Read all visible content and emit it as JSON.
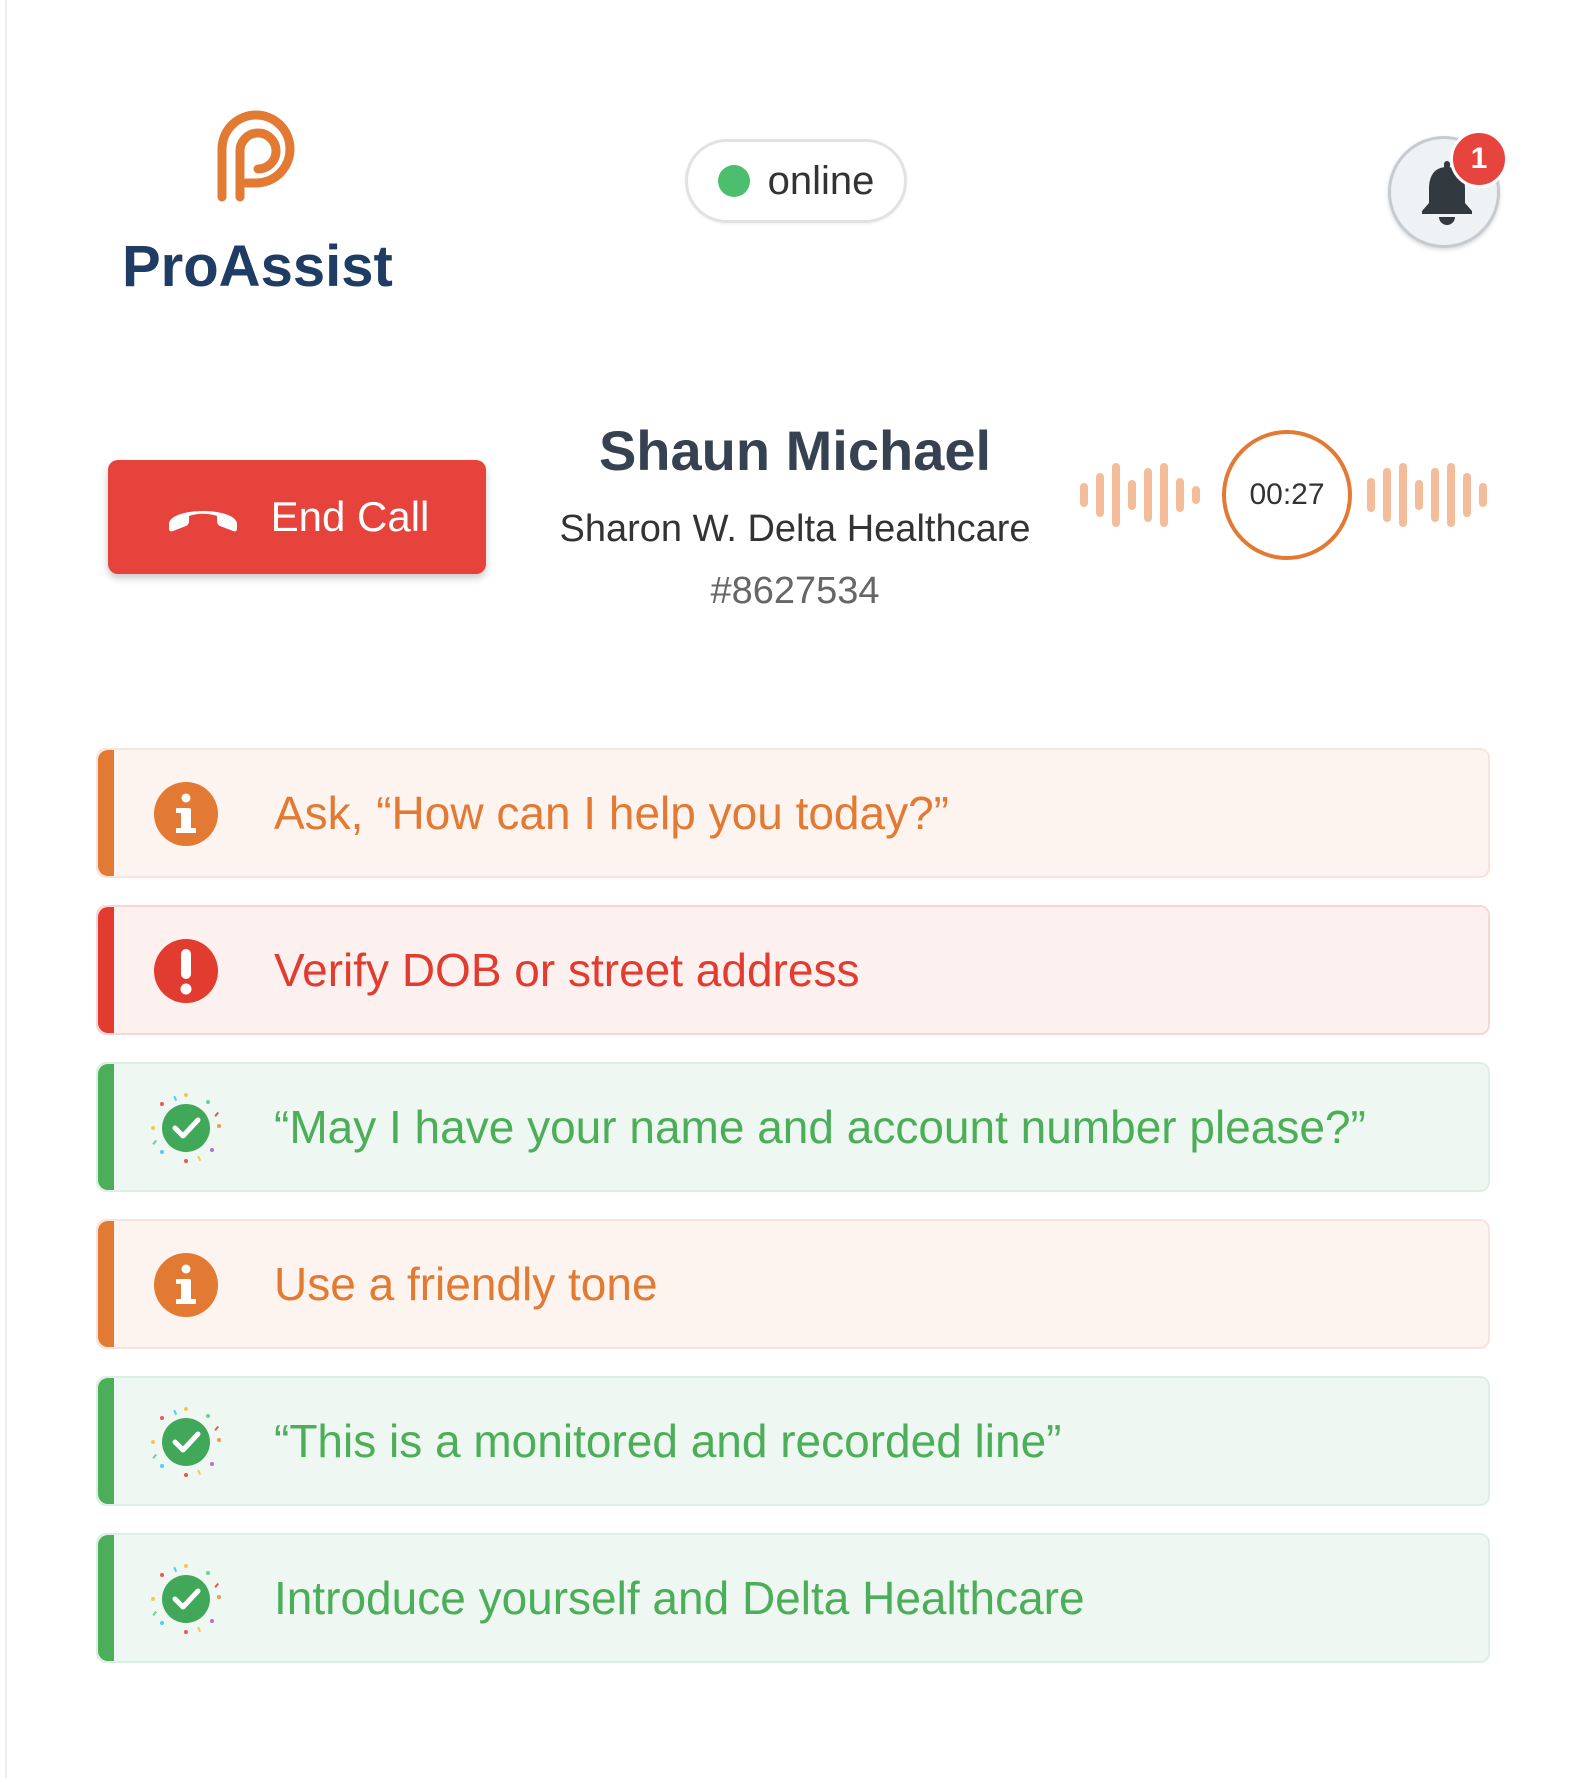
{
  "brand": {
    "name": "ProAssist",
    "accent": "#e27a34",
    "text_color": "#1f3c64"
  },
  "status": {
    "label": "online",
    "color": "#4cbf6e"
  },
  "notifications": {
    "count": "1",
    "icon": "bell-icon"
  },
  "call": {
    "end_label": "End Call",
    "end_icon": "phone-hangup-icon",
    "caller_name": "Shaun Michael",
    "caller_org": "Sharon W. Delta Healthcare",
    "caller_id": "#8627534",
    "timer": "00:27"
  },
  "tasks": [
    {
      "type": "info",
      "icon": "info-icon",
      "text": "Ask, “How can I help you today?”"
    },
    {
      "type": "warn",
      "icon": "alert-icon",
      "text": "Verify DOB or street address"
    },
    {
      "type": "done",
      "icon": "check-celebrate-icon",
      "text": "“May I have your name and account number please?”"
    },
    {
      "type": "info",
      "icon": "info-icon",
      "text": "Use a friendly tone"
    },
    {
      "type": "done",
      "icon": "check-celebrate-icon",
      "text": "“This is a monitored and recorded line”"
    },
    {
      "type": "done",
      "icon": "check-celebrate-icon",
      "text": "Introduce yourself and Delta Healthcare"
    }
  ]
}
